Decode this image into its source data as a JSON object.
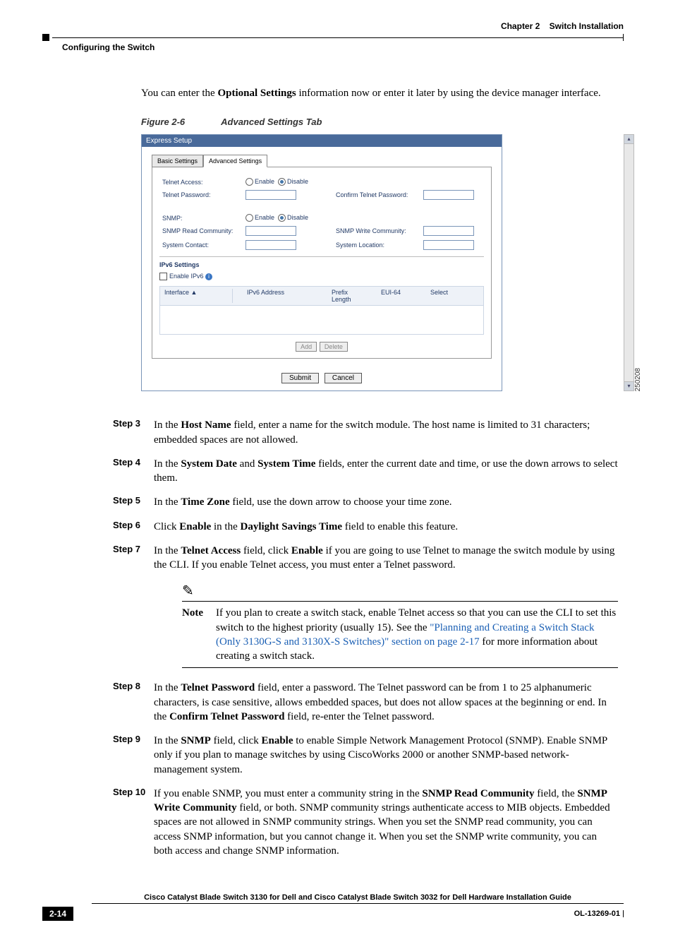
{
  "header": {
    "left": "Configuring the Switch",
    "right_chapter": "Chapter 2",
    "right_title": "Switch Installation"
  },
  "intro": {
    "pre": "You can enter the ",
    "bold": "Optional Settings",
    "post": " information now or enter it later by using the device manager interface."
  },
  "figure": {
    "label": "Figure 2-6",
    "caption": "Advanced Settings Tab",
    "window_title": "Express Setup",
    "tabs": {
      "basic": "Basic Settings",
      "advanced": "Advanced Settings"
    },
    "labels": {
      "telnet_access": "Telnet Access:",
      "telnet_password": "Telnet Password:",
      "confirm_telnet": "Confirm Telnet Password:",
      "snmp": "SNMP:",
      "snmp_read": "SNMP Read Community:",
      "snmp_write": "SNMP Write Community:",
      "sys_contact": "System Contact:",
      "sys_location": "System Location:",
      "enable": "Enable",
      "disable": "Disable",
      "ipv6_title": "IPv6 Settings",
      "enable_ipv6": "Enable IPv6",
      "col_interface": "Interface ▲",
      "col_ipv6addr": "IPv6 Address",
      "col_prefix": "Prefix Length",
      "col_eui": "EUI-64",
      "col_select": "Select",
      "btn_add": "Add",
      "btn_delete": "Delete",
      "btn_submit": "Submit",
      "btn_cancel": "Cancel"
    },
    "image_id": "250208"
  },
  "steps": {
    "s3": {
      "label": "Step 3",
      "t1": "In the ",
      "b1": "Host Name",
      "t2": " field, enter a name for the switch module. The host name is limited to 31 characters; embedded spaces are not allowed."
    },
    "s4": {
      "label": "Step 4",
      "t1": "In the ",
      "b1": "System Date",
      "t2": " and ",
      "b2": "System Time",
      "t3": " fields, enter the current date and time, or use the down arrows to select them."
    },
    "s5": {
      "label": "Step 5",
      "t1": "In the ",
      "b1": "Time Zone",
      "t2": " field, use the down arrow to choose your time zone."
    },
    "s6": {
      "label": "Step 6",
      "t1": "Click ",
      "b1": "Enable",
      "t2": " in the ",
      "b2": "Daylight Savings Time",
      "t3": " field to enable this feature."
    },
    "s7": {
      "label": "Step 7",
      "t1": "In the ",
      "b1": "Telnet Access",
      "t2": " field, click ",
      "b2": "Enable",
      "t3": " if you are going to use Telnet to manage the switch module by using the CLI. If you enable Telnet access, you must enter a Telnet password."
    },
    "s8": {
      "label": "Step 8",
      "t1": "In the ",
      "b1": "Telnet Password",
      "t2": " field, enter a password. The Telnet password can be from 1 to 25 alphanumeric characters, is case sensitive, allows embedded spaces, but does not allow spaces at the beginning or end. In the ",
      "b2": "Confirm Telnet Password",
      "t3": " field, re-enter the Telnet password."
    },
    "s9": {
      "label": "Step 9",
      "t1": "In the ",
      "b1": "SNMP",
      "t2": " field, click ",
      "b2": "Enable",
      "t3": " to enable Simple Network Management Protocol (SNMP). Enable SNMP only if you plan to manage switches by using CiscoWorks 2000 or another SNMP-based network-management system."
    },
    "s10": {
      "label": "Step 10",
      "t1": "If you enable SNMP, you must enter a community string in the ",
      "b1": "SNMP Read Community",
      "t2": " field, the ",
      "b2": "SNMP Write Community",
      "t3": " field, or both. SNMP community strings authenticate access to MIB objects. Embedded spaces are not allowed in SNMP community strings. When you set the SNMP read community, you can access SNMP information, but you cannot change it. When you set the SNMP write community, you can both access and change SNMP information."
    }
  },
  "note": {
    "label": "Note",
    "t1": "If you plan to create a switch stack, enable Telnet access so that you can use the CLI to set this switch to the highest priority (usually 15). See the ",
    "link": "\"Planning and Creating a Switch Stack (Only 3130G-S and 3130X-S Switches)\" section on page 2-17",
    "t2": " for more information about creating a switch stack."
  },
  "footer": {
    "title": "Cisco Catalyst Blade Switch 3130 for Dell and Cisco Catalyst Blade Switch 3032 for Dell Hardware Installation Guide",
    "page": "2-14",
    "doc": "OL-13269-01"
  }
}
